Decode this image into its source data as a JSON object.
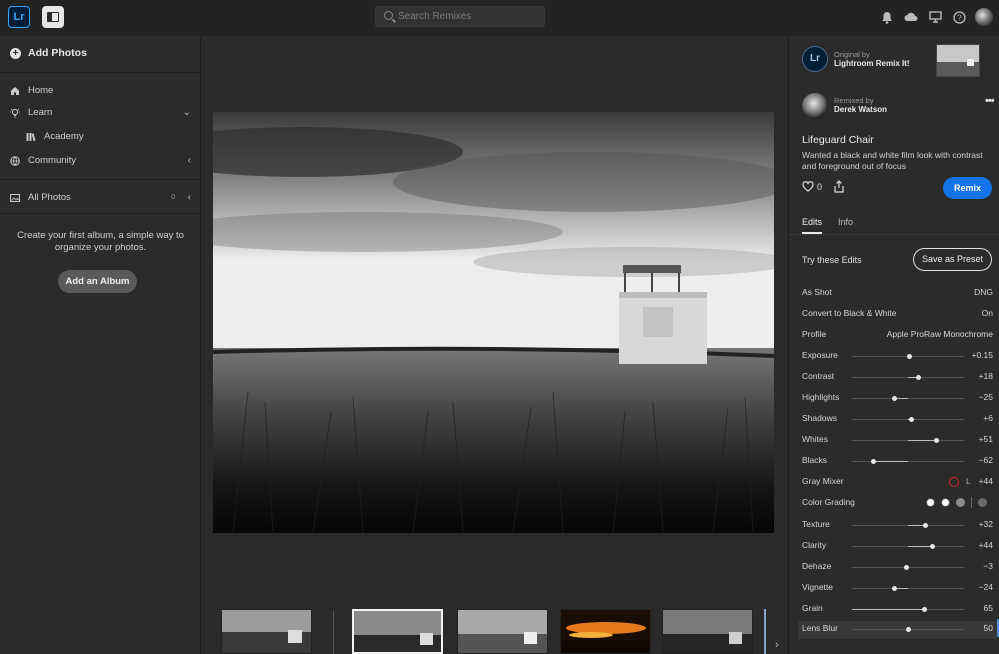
{
  "app": {
    "logo": "Lr"
  },
  "search": {
    "placeholder": "Search Remixes"
  },
  "sidebar": {
    "add_photos": "Add Photos",
    "home": "Home",
    "learn": "Learn",
    "academy": "Academy",
    "community": "Community",
    "all_photos": "All Photos",
    "all_photos_count": "0",
    "empty_text": "Create your first album, a simple way to organize your photos.",
    "add_album": "Add an Album"
  },
  "remix": {
    "original_by_label": "Original by",
    "original_by_name": "Lightroom Remix It!",
    "remixed_by_label": "Remixed by",
    "remixed_by_name": "Derek Watson",
    "title": "Lifeguard Chair",
    "description": "Wanted a black and white film look with contrast and foreground out of focus",
    "likes": "0",
    "remix_button": "Remix"
  },
  "tabs": [
    {
      "label": "Edits"
    },
    {
      "label": "Info"
    }
  ],
  "edits": {
    "try_label": "Try these Edits",
    "save_preset": "Save as Preset",
    "rows": [
      {
        "label": "As Shot",
        "value": "DNG"
      },
      {
        "label": "Convert to Black & White",
        "value": "On"
      },
      {
        "label": "Profile",
        "value": "Apple ProRaw Monochrome"
      },
      {
        "label": "Exposure",
        "value": "+0.15",
        "level": 0.51
      },
      {
        "label": "Contrast",
        "value": "+18",
        "level": 0.59
      },
      {
        "label": "Highlights",
        "value": "−25",
        "level": 0.375
      },
      {
        "label": "Shadows",
        "value": "+6",
        "level": 0.53
      },
      {
        "label": "Whites",
        "value": "+51",
        "level": 0.755
      },
      {
        "label": "Blacks",
        "value": "−62",
        "level": 0.19
      },
      {
        "label": "Gray Mixer",
        "value": "+44",
        "channel": "L"
      },
      {
        "label": "Color Grading",
        "value": ""
      },
      {
        "label": "Texture",
        "value": "+32",
        "level": 0.66
      },
      {
        "label": "Clarity",
        "value": "+44",
        "level": 0.72
      },
      {
        "label": "Dehaze",
        "value": "−3",
        "level": 0.485
      },
      {
        "label": "Vignette",
        "value": "−24",
        "level": 0.38
      },
      {
        "label": "Grain",
        "value": "65",
        "level": 0.65,
        "from_zero": true
      },
      {
        "label": "Lens Blur",
        "value": "50",
        "level": 0.5
      }
    ]
  },
  "colors": {
    "accent": "#1473e6",
    "gray_mixer_ring": "#dd2222"
  }
}
